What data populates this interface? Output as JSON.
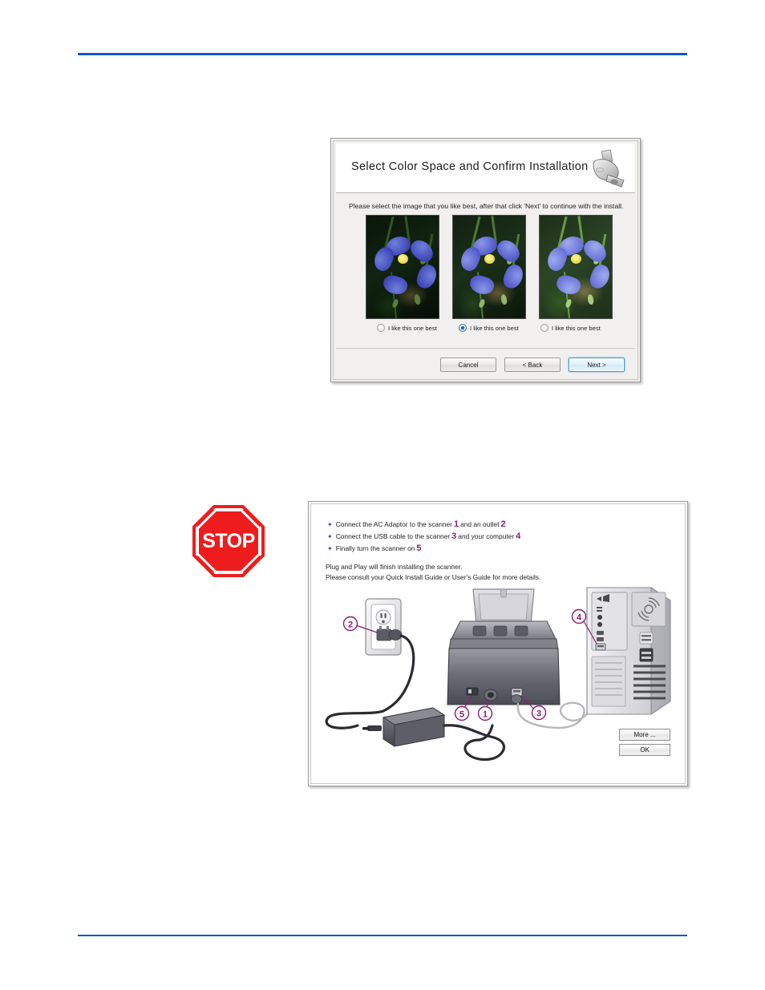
{
  "page": {
    "background": "#ffffff",
    "rule_color": "#1256c4"
  },
  "color_space_dialog": {
    "title": "Select Color Space and Confirm Installation",
    "instruction": "Please select the image that you like best, after that click 'Next' to continue with the install.",
    "header_icon": "scanner-icon",
    "images": [
      {
        "id": "image-1",
        "alt": "blue flax flower, dark exposure"
      },
      {
        "id": "image-2",
        "alt": "blue flax flower, medium exposure"
      },
      {
        "id": "image-3",
        "alt": "blue flax flower, bright exposure"
      }
    ],
    "options": [
      {
        "label": "I like this one best",
        "selected": false
      },
      {
        "label": "I like this one best",
        "selected": true
      },
      {
        "label": "I like this one best",
        "selected": false
      }
    ],
    "buttons": {
      "cancel": "Cancel",
      "back": "< Back",
      "next": "Next >"
    },
    "accent_color": "#3c9bd0"
  },
  "stop_sign": {
    "label": "STOP",
    "fill_color": "#ee1c1c",
    "border_color": "#ffffff"
  },
  "connect_dialog": {
    "steps": [
      {
        "bullet": "✦",
        "part1": "Connect the AC Adaptor to the scanner",
        "num1": "1",
        "part2": "and an outlet",
        "num2": "2"
      },
      {
        "bullet": "✦",
        "part1": "Connect the USB cable to the scanner",
        "num1": "3",
        "part2": "and your computer",
        "num2": "4"
      },
      {
        "bullet": "✦",
        "part1": "Finally turn the scanner on",
        "num1": "5",
        "part2": "",
        "num2": ""
      }
    ],
    "note_line1": "Plug and Play will finish installing the scanner.",
    "note_line2": "Please consult your Quick Install Guide or User's Guide for more details.",
    "callouts": [
      {
        "id": "1",
        "target": "scanner-power-port"
      },
      {
        "id": "2",
        "target": "wall-outlet-plug"
      },
      {
        "id": "3",
        "target": "scanner-usb-port"
      },
      {
        "id": "4",
        "target": "computer-usb-port"
      },
      {
        "id": "5",
        "target": "scanner-power-switch"
      }
    ],
    "buttons": {
      "more": "More ...",
      "ok": "OK"
    },
    "callout_color": "#8e1a73"
  }
}
